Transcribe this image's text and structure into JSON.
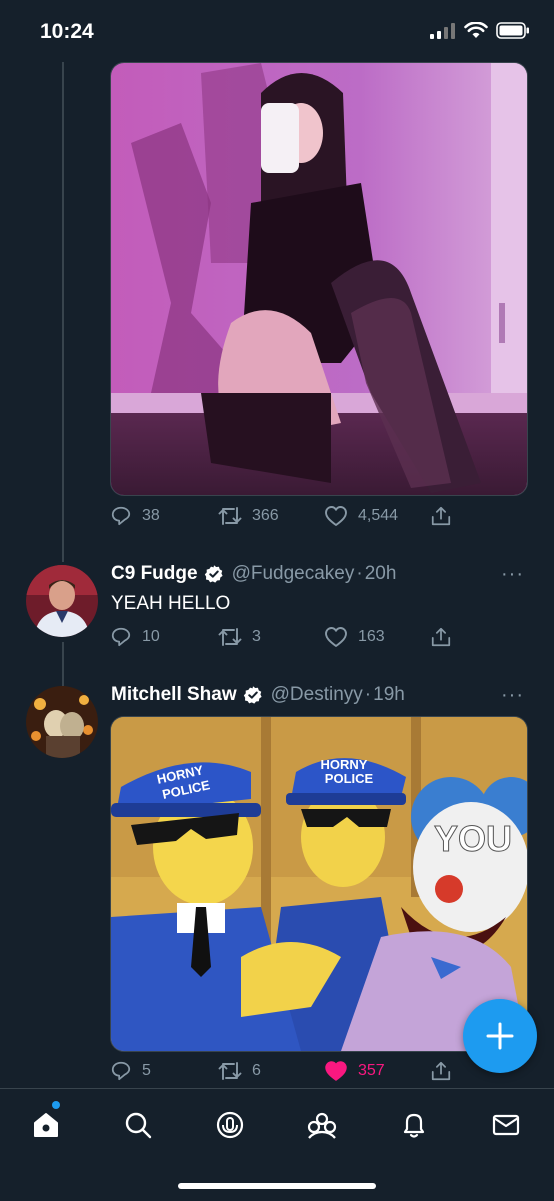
{
  "status_bar": {
    "time": "10:24"
  },
  "tweets": [
    {
      "replies": "38",
      "retweets": "366",
      "likes": "4,544"
    },
    {
      "name": "C9 Fudge",
      "handle": "@Fudgecakey",
      "separator": "·",
      "time": "20h",
      "text": "YEAH HELLO",
      "replies": "10",
      "retweets": "3",
      "likes": "163",
      "more": "···"
    },
    {
      "name": "Mitchell Shaw",
      "handle": "@Destinyy",
      "separator": "·",
      "time": "19h",
      "replies": "5",
      "retweets": "6",
      "likes": "357",
      "liked": true,
      "more": "···",
      "meme": {
        "hat_text": "HORNY POLICE",
        "hat_line1": "HORNY",
        "hat_line2": "POLICE",
        "caption": "YOU"
      }
    }
  ],
  "colors": {
    "background": "#15202b",
    "accent": "#1d9bf0",
    "like_active": "#f91880",
    "muted": "#8899a6"
  },
  "nav": [
    "home-icon",
    "search-icon",
    "spaces-icon",
    "communities-icon",
    "notifications-icon",
    "messages-icon"
  ]
}
